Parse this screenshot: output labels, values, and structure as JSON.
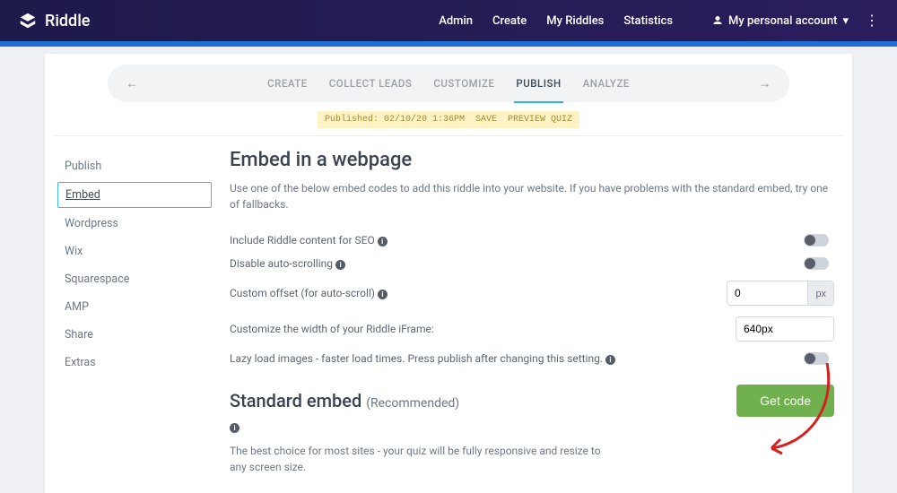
{
  "brand": "Riddle",
  "topnav": {
    "admin": "Admin",
    "create": "Create",
    "myriddles": "My Riddles",
    "statistics": "Statistics",
    "account": "My personal account"
  },
  "steps": {
    "create": "CREATE",
    "collect": "COLLECT LEADS",
    "customize": "CUSTOMIZE",
    "publish": "PUBLISH",
    "analyze": "ANALYZE"
  },
  "banner": {
    "published": "Published: 02/10/20 1:36PM",
    "save": "SAVE",
    "preview": "PREVIEW QUIZ"
  },
  "sidebar": {
    "publish": "Publish",
    "embed": "Embed",
    "wordpress": "Wordpress",
    "wix": "Wix",
    "squarespace": "Squarespace",
    "amp": "AMP",
    "share": "Share",
    "extras": "Extras"
  },
  "main": {
    "title": "Embed in a webpage",
    "subtitle": "Use one of the below embed codes to add this riddle into your website. If you have problems with the standard embed, try one of fallbacks.",
    "rows": {
      "seo": "Include Riddle content for SEO",
      "disable_autoscroll": "Disable auto-scrolling",
      "custom_offset": "Custom offset (for auto-scroll)",
      "offset_value": "0",
      "offset_unit": "px",
      "iframe_width_label": "Customize the width of your Riddle iFrame:",
      "iframe_width_value": "640px",
      "lazy": "Lazy load images - faster load times. Press publish after changing this setting."
    },
    "std_title": "Standard embed",
    "std_rec": "(Recommended)",
    "getcode": "Get code",
    "std_desc": "The best choice for most sites - your quiz will be fully responsive and resize to any screen size."
  }
}
